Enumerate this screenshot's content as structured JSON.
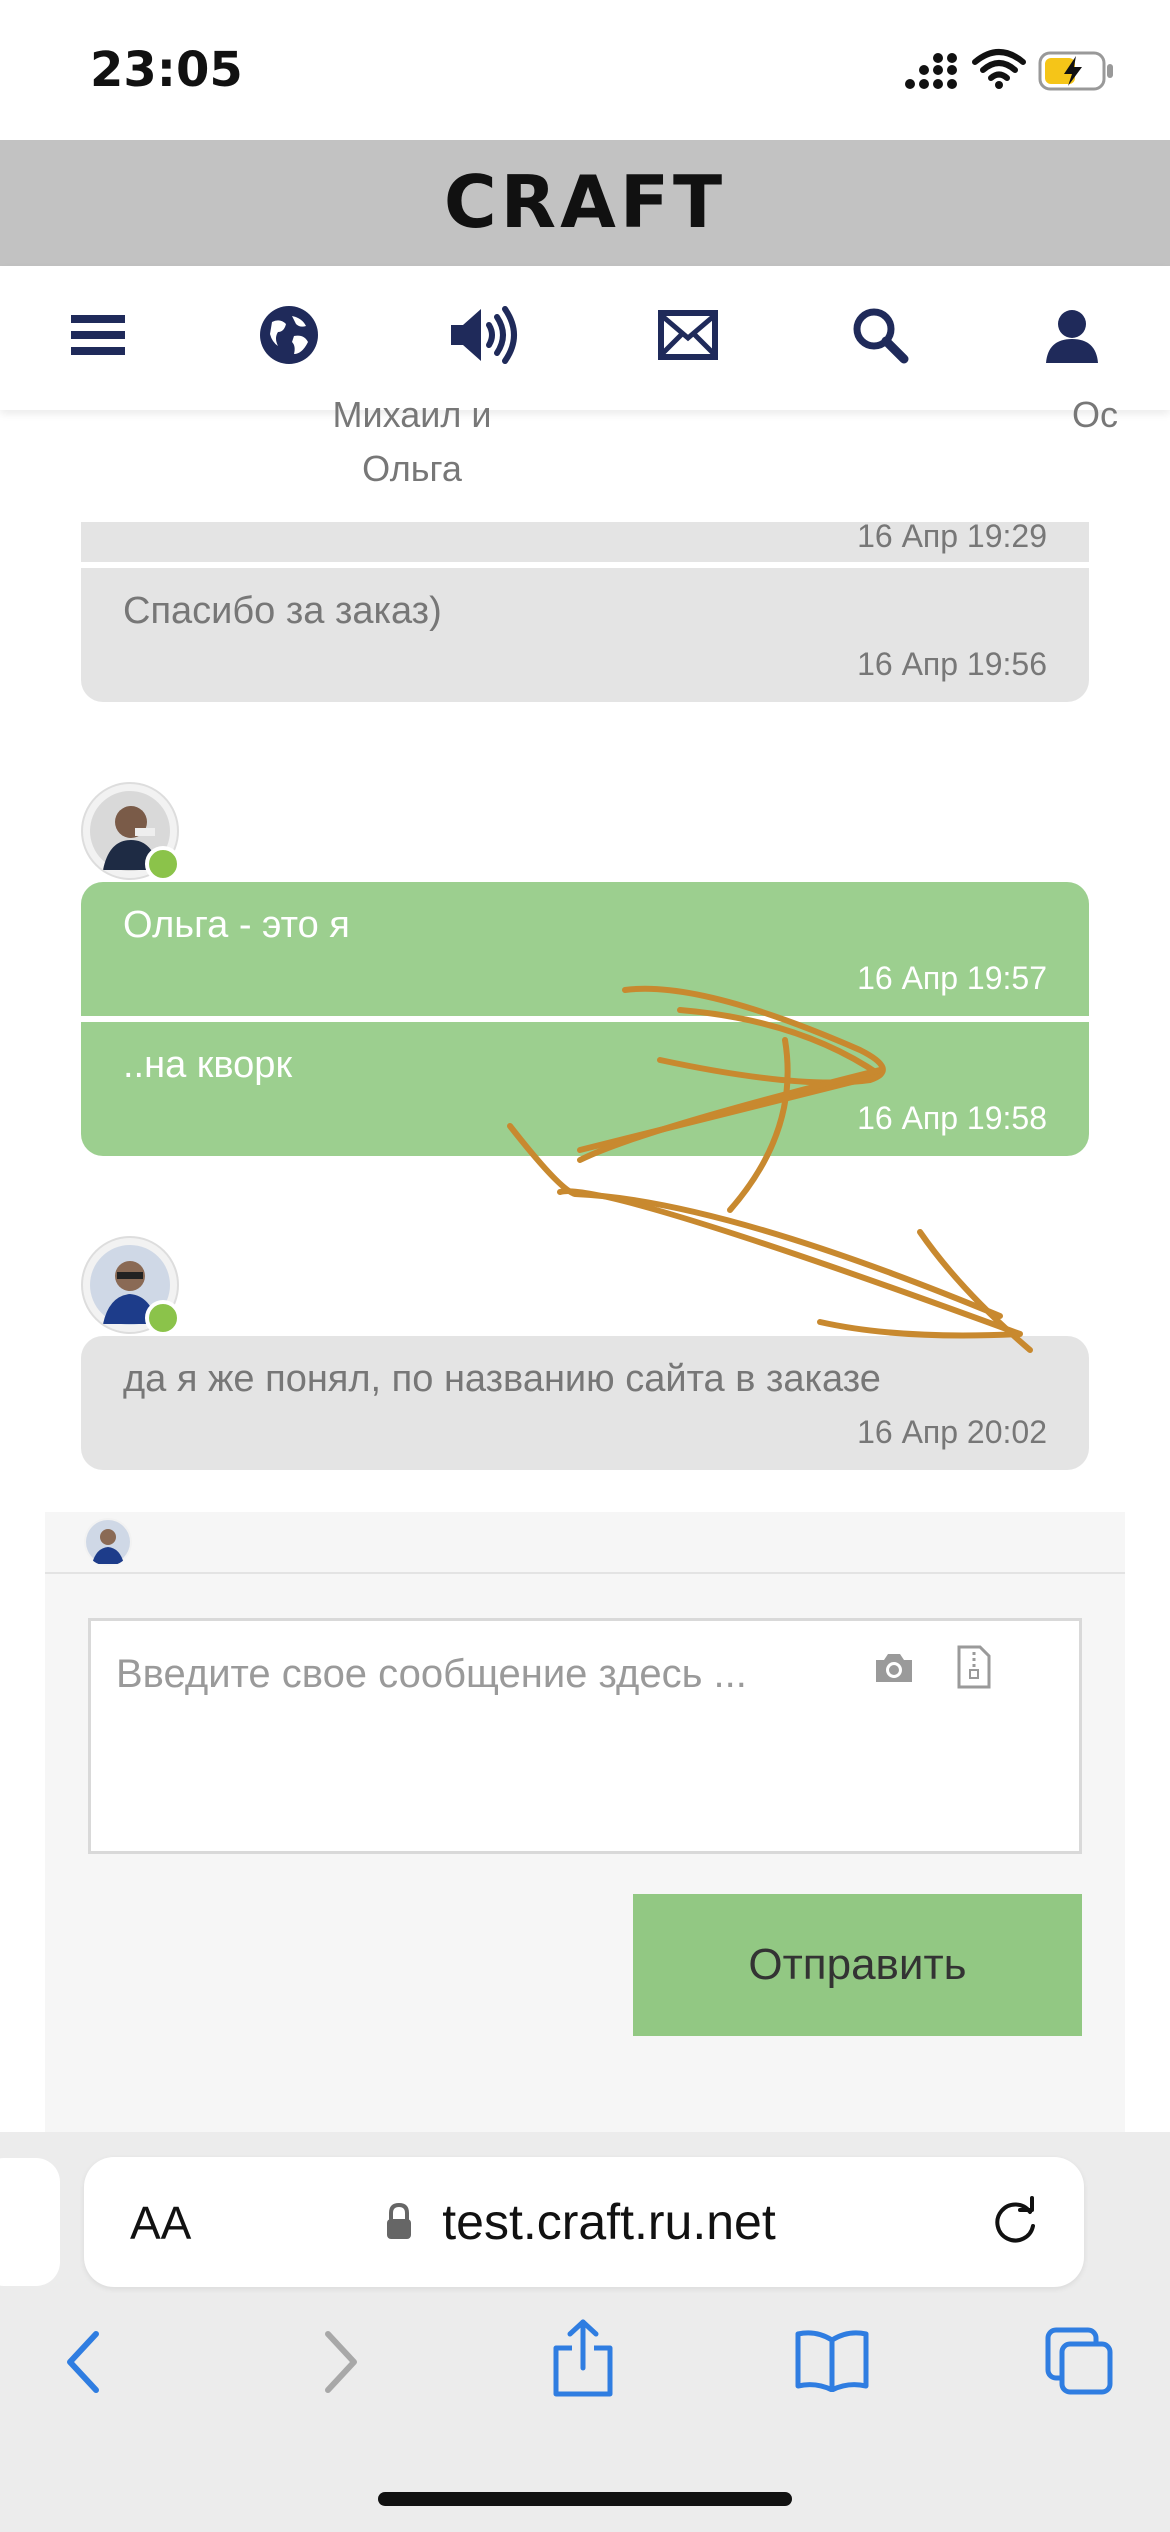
{
  "status_bar": {
    "time": "23:05"
  },
  "site": {
    "logo": "CRAFT"
  },
  "nav": {
    "icons": [
      "menu-icon",
      "globe-icon",
      "speaker-icon",
      "mail-icon",
      "search-icon",
      "user-icon"
    ]
  },
  "top_names": {
    "left": "Михаил и",
    "left_line2": "Ольга",
    "right": "Ос"
  },
  "chat": {
    "partial_time": "16 Апр 19:29",
    "messages": [
      {
        "text": "Спасибо за заказ)",
        "time": "16 Апр 19:56",
        "side": "gray"
      },
      {
        "text": "Ольга - это я",
        "time": "16 Апр 19:57",
        "side": "green"
      },
      {
        "text": "..на кворк",
        "time": "16 Апр 19:58",
        "side": "green"
      },
      {
        "text": "да я же понял, по названию сайта в заказе",
        "time": "16 Апр 20:02",
        "side": "gray"
      }
    ]
  },
  "composer": {
    "placeholder": "Введите свое сообщение здесь ...",
    "send_label": "Отправить"
  },
  "browser": {
    "aa": "AA",
    "url": "test.craft.ru.net"
  },
  "colors": {
    "green_bubble": "#9ccf8f",
    "gray_bubble": "#e4e4e4",
    "send_button": "#92c883",
    "annotation": "#c8892f",
    "nav_icon": "#1f2a5a",
    "ios_blue": "#2f7de1"
  }
}
